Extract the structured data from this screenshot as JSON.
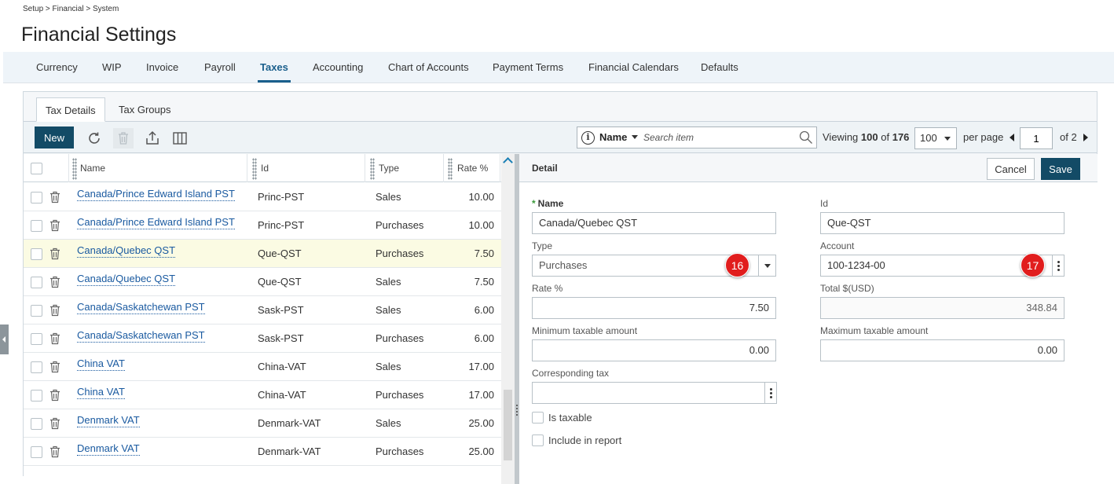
{
  "breadcrumb": "Setup > Financial > System",
  "page_title": "Financial Settings",
  "nav_tabs": [
    {
      "label": "Currency",
      "active": false
    },
    {
      "label": "WIP",
      "active": false
    },
    {
      "label": "Invoice",
      "active": false
    },
    {
      "label": "Payroll",
      "active": false
    },
    {
      "label": "Taxes",
      "active": true
    },
    {
      "label": "Accounting",
      "active": false
    },
    {
      "label": "Chart of Accounts",
      "active": false
    },
    {
      "label": "Payment Terms",
      "active": false
    },
    {
      "label": "Financial Calendars",
      "active": false
    },
    {
      "label": "Defaults",
      "active": false
    }
  ],
  "subtabs": [
    {
      "label": "Tax Details",
      "active": true
    },
    {
      "label": "Tax Groups",
      "active": false
    }
  ],
  "toolbar": {
    "new_label": "New",
    "icons": [
      "refresh-icon",
      "trash-icon",
      "export-icon",
      "columns-icon"
    ],
    "search_field": "Name",
    "search_placeholder": "Search item",
    "viewing_prefix": "Viewing",
    "viewing_count": "100",
    "viewing_of": "of",
    "viewing_total": "176",
    "per_page_value": "100",
    "per_page_label": "per page",
    "page_value": "1",
    "page_of": "of 2"
  },
  "grid": {
    "columns": {
      "name": "Name",
      "id": "Id",
      "type": "Type",
      "rate": "Rate %"
    },
    "rows": [
      {
        "name": "Canada/Prince Edward Island PST",
        "id": "Princ-PST",
        "type": "Sales",
        "rate": "10.00",
        "highlighted": false
      },
      {
        "name": "Canada/Prince Edward Island PST",
        "id": "Princ-PST",
        "type": "Purchases",
        "rate": "10.00",
        "highlighted": false
      },
      {
        "name": "Canada/Quebec QST",
        "id": "Que-QST",
        "type": "Purchases",
        "rate": "7.50",
        "highlighted": true
      },
      {
        "name": "Canada/Quebec QST",
        "id": "Que-QST",
        "type": "Sales",
        "rate": "7.50",
        "highlighted": false
      },
      {
        "name": "Canada/Saskatchewan PST",
        "id": "Sask-PST",
        "type": "Sales",
        "rate": "6.00",
        "highlighted": false
      },
      {
        "name": "Canada/Saskatchewan PST",
        "id": "Sask-PST",
        "type": "Purchases",
        "rate": "6.00",
        "highlighted": false
      },
      {
        "name": "China VAT",
        "id": "China-VAT",
        "type": "Sales",
        "rate": "17.00",
        "highlighted": false
      },
      {
        "name": "China VAT",
        "id": "China-VAT",
        "type": "Purchases",
        "rate": "17.00",
        "highlighted": false
      },
      {
        "name": "Denmark VAT",
        "id": "Denmark-VAT",
        "type": "Sales",
        "rate": "25.00",
        "highlighted": false
      },
      {
        "name": "Denmark VAT",
        "id": "Denmark-VAT",
        "type": "Purchases",
        "rate": "25.00",
        "highlighted": false
      }
    ]
  },
  "detail": {
    "title": "Detail",
    "cancel_label": "Cancel",
    "save_label": "Save",
    "name_label": "Name",
    "name_value": "Canada/Quebec QST",
    "id_label": "Id",
    "id_value": "Que-QST",
    "type_label": "Type",
    "type_value": "Purchases",
    "account_label": "Account",
    "account_value": "100-1234-00",
    "rate_label": "Rate %",
    "rate_value": "7.50",
    "total_label": "Total $(USD)",
    "total_value": "348.84",
    "min_label": "Minimum taxable amount",
    "min_value": "0.00",
    "max_label": "Maximum taxable amount",
    "max_value": "0.00",
    "corresponding_label": "Corresponding tax",
    "corresponding_value": "",
    "is_taxable_label": "Is taxable",
    "include_report_label": "Include in report",
    "badge_type": "16",
    "badge_account": "17"
  },
  "colors": {
    "accent": "#1a5f8c",
    "button_dark": "#134b66",
    "link": "#1a5aa0",
    "highlight_row": "#fbfbe3",
    "badge": "#e11d1d"
  }
}
